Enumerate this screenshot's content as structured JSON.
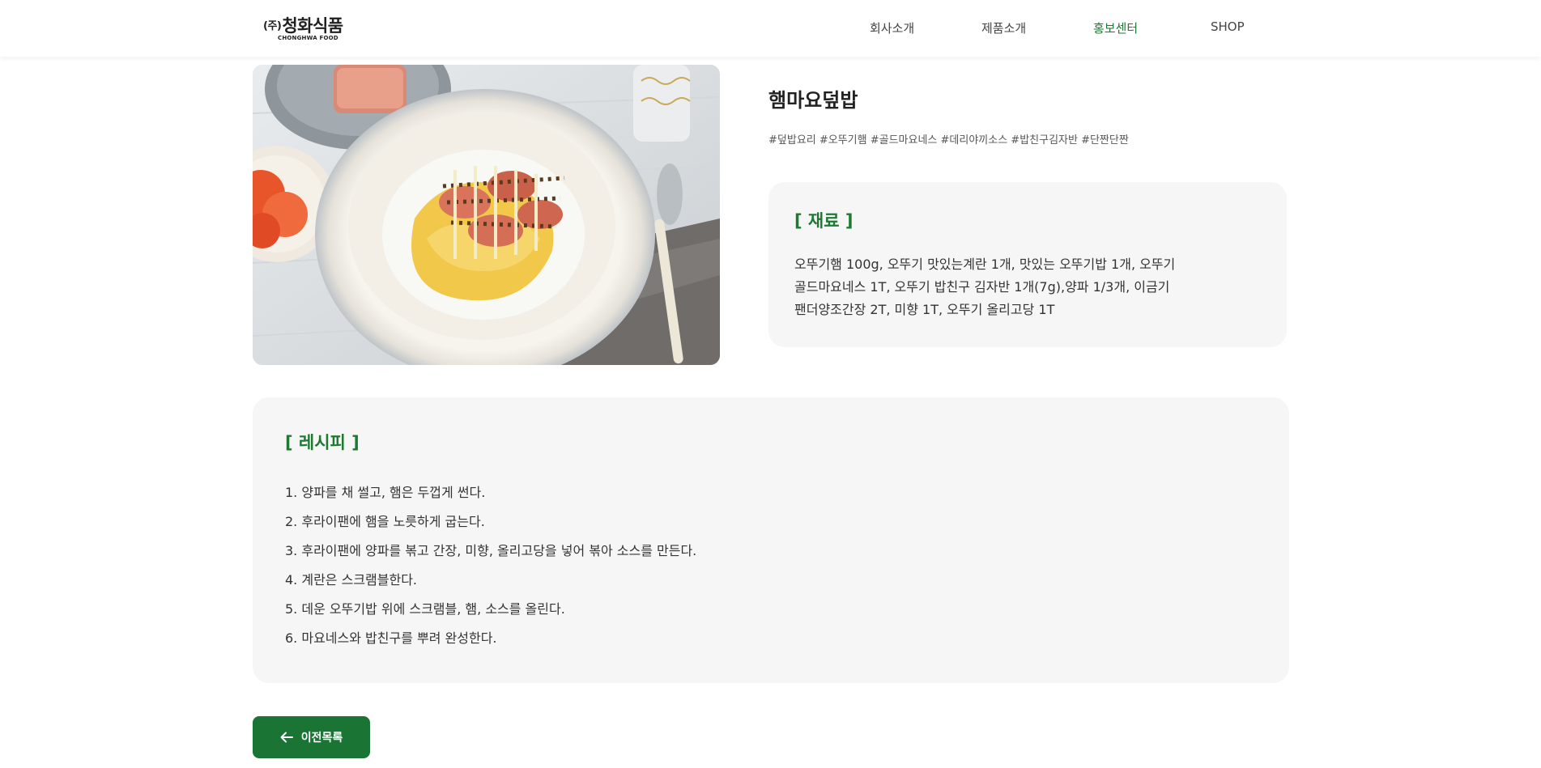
{
  "header": {
    "logo": {
      "prefix": "(주)",
      "name": "청화식품",
      "sub": "CHONGHWA FOOD"
    },
    "nav": [
      {
        "label": "회사소개",
        "active": false
      },
      {
        "label": "제품소개",
        "active": false
      },
      {
        "label": "홍보센터",
        "active": true
      },
      {
        "label": "SHOP",
        "active": false
      }
    ]
  },
  "colors": {
    "accent": "#1e7a33",
    "button": "#1a7535",
    "panel": "#f6f6f6"
  },
  "recipe": {
    "image_alt": "햄마요덮밥",
    "title": "햄마요덮밥",
    "tags": "#덮밥요리 #오뚜기햄 #골드마요네스 #데리야끼소스 #밥친구김자반 #단짠단짠",
    "ingredients": {
      "heading": "[ 재료 ]",
      "lines": [
        "오뚜기햄 100g, 오뚜기 맛있는계란 1개, 맛있는 오뚜기밥 1개, 오뚜기",
        "골드마요네스 1T, 오뚜기 밥친구 김자반 1개(7g),양파 1/3개, 이금기",
        "팬더양조간장 2T, 미향 1T, 오뚜기 올리고당 1T"
      ]
    },
    "method": {
      "heading": "[ 레시피 ]",
      "steps": [
        "1. 양파를 채 썰고, 햄은 두껍게 썬다.",
        "2. 후라이팬에 햄을 노릇하게 굽는다.",
        "3. 후라이팬에 양파를 볶고 간장, 미향, 올리고당을 넣어 볶아 소스를 만든다.",
        "4. 계란은 스크램블한다.",
        "5. 데운 오뚜기밥 위에 스크램블, 햄, 소스를 올린다.",
        "6. 마요네스와 밥친구를 뿌려 완성한다."
      ]
    }
  },
  "back_button": {
    "label": "이전목록",
    "icon": "arrow-left-icon"
  }
}
